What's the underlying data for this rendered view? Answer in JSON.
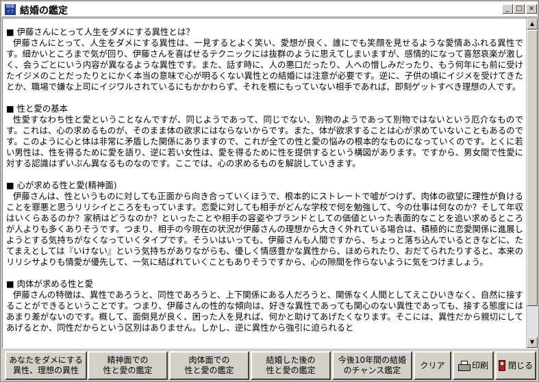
{
  "window": {
    "icon_text": "結婚ﾍﾟｱ",
    "title": "結婚の鑑定"
  },
  "controls": {
    "minimize": "_",
    "maximize": "□",
    "close": "×"
  },
  "sections": [
    {
      "heading": "■ 伊藤さんにとって人生をダメにする異性とは？",
      "body": "伊藤さんにとって、人生をダメにする異性は、一見するとよく笑い、愛想が良く、誰にでも笑顔を見せるような愛情あふれる異性です。細かいところまで気が回り、伊藤さんを喜ばせるテクニックには抜群のように思えてしまいますが、感情的になって喜怒哀楽が激しく、会うごとにいう内容が異なるような異性です。また、話す時に、人の悪口だったり、人への憎しみだったり、もう何年にも前に受けたイジメのことだったりとにかく本当の意味で心が明るくない異性との結婚には注意が必要です。逆に、子供の頃にイジメを受けてきたとか、職場で嫌な上司にイジワルされているにもかかわらず、それを根にもっていない相手であれば、即刻ゲットすべき理想の人です。"
    },
    {
      "heading": "■ 性と愛の基本",
      "body": "性愛すなわち性と愛ということなんですが、同じようであって、同じでない、別物のようであって別物ではないという厄介なものです。これは、心の求めるものが、そのまま体の欲求にはならないからです。また、体が欲求することは心が求めていないこともあるのです。このように心と体は非常に矛盾した関係にありますので、これが全ての性と愛の悩みの根本的なものになっていくのです。とくに若い男性は、性を得るために愛を語り、逆に若い女性は、愛を得るために性を提供するという構図があります。ですから、男女間で性愛に対する認識はずいぶん異なるものなのです。ここでは、心の求めるものを解説していきます。"
    },
    {
      "heading": "■ 心が求める性と愛(精神面)",
      "body": "伊藤さんは、性というものに対しても正面から向き合っていくほうで、根本的にストレートで嘘がつけず、肉体の欲望に理性が負けることを罪悪と思うリリシイところをもっています。恋愛に対しても相手がどんな学校で何を勉強して、今の仕事は何なのか？そして年収はいくらあるのか？家柄はどうなのか？といったことや相手の容姿やブランドとしての価値といった表面的なことを追い求めるところが人よりも多くありそうです。つまり、相手の今現在の状況が伊藤さんの理想から大きく外れている場合は、積極的に恋愛関係に進展しようとする気持ちがなくなっていくタイプです。そういはいっても、伊藤さんも人間ですから、ちょっと落ち込んでいるときなどに、たてまえとしては『いけない』という気持ちがありながらも、優しく情感豊かな異性から、ほめられたり、おだてられたりすると、本来のリリシサよりも情愛が優先して、一気に結ばれていくこともありそうですから、心の隙間を作らないように気をつけましょう。"
    },
    {
      "heading": "■ 肉体が求める性と愛",
      "body": "伊藤さんの特徴は、異性であろうと、同性であろうと、上下関係にある人だろうと、関係なく人間としてえこひいきなく、自然に接することができるということです。つまり、伊藤さんの性的な傾向は、好きな異性であっても関心のない異性であっても、接する態度にはあまり差がないのです。概して、面倒見が良く、困った人を見れば、何かと助けてあげたくなります。そこには、異性だから親切にしてあげるとか、同性だからという区別はありません。しかし、逆に異性から強引に迫られると"
    }
  ],
  "scrollbar": {
    "up_arrow": "▲",
    "down_arrow": "▼"
  },
  "toolbar": {
    "btn1": [
      "あなたをダメにする",
      "異性、理想の異性"
    ],
    "btn2": [
      "精神面での",
      "性と愛の鑑定"
    ],
    "btn3": [
      "肉体面での",
      "性と愛の鑑定"
    ],
    "btn4": [
      "結婚した後の",
      "性と愛の鑑定"
    ],
    "btn5": [
      "今後10年間の結婚",
      "のチャンス鑑定"
    ],
    "clear": "クリア",
    "print": "印刷",
    "close": "閉じる"
  }
}
